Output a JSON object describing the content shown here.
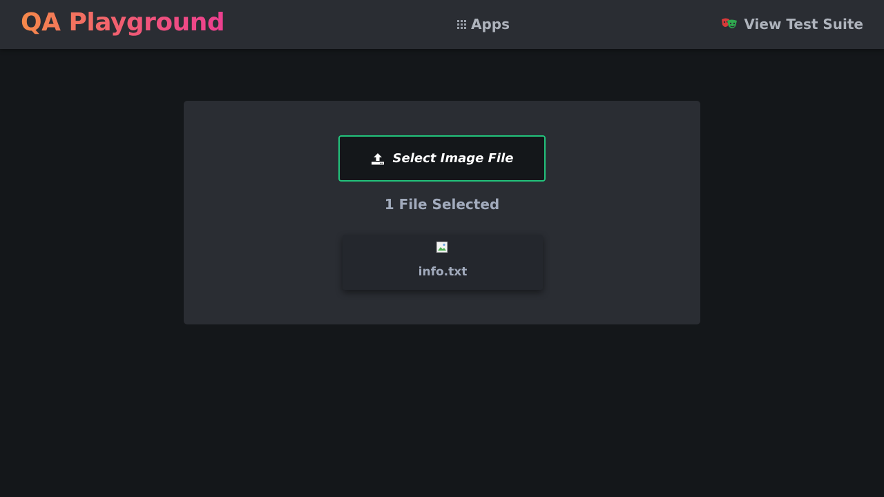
{
  "header": {
    "logo_text": "QA Playground",
    "apps_icon": "grid-icon",
    "apps_label": "Apps",
    "suite_icon": "theater-masks-icon",
    "suite_label": "View Test Suite"
  },
  "upload": {
    "button_icon": "upload-icon",
    "button_label": "Select Image File",
    "status_text": "1 File Selected",
    "accent_color": "#22c37c"
  },
  "files": [
    {
      "name": "info.txt",
      "thumbnail_icon": "broken-image-icon"
    }
  ],
  "colors": {
    "background": "#14171a",
    "surface": "#2a2d33",
    "logo_gradient_start": "#f5894a",
    "logo_gradient_end": "#ec3f8f"
  }
}
